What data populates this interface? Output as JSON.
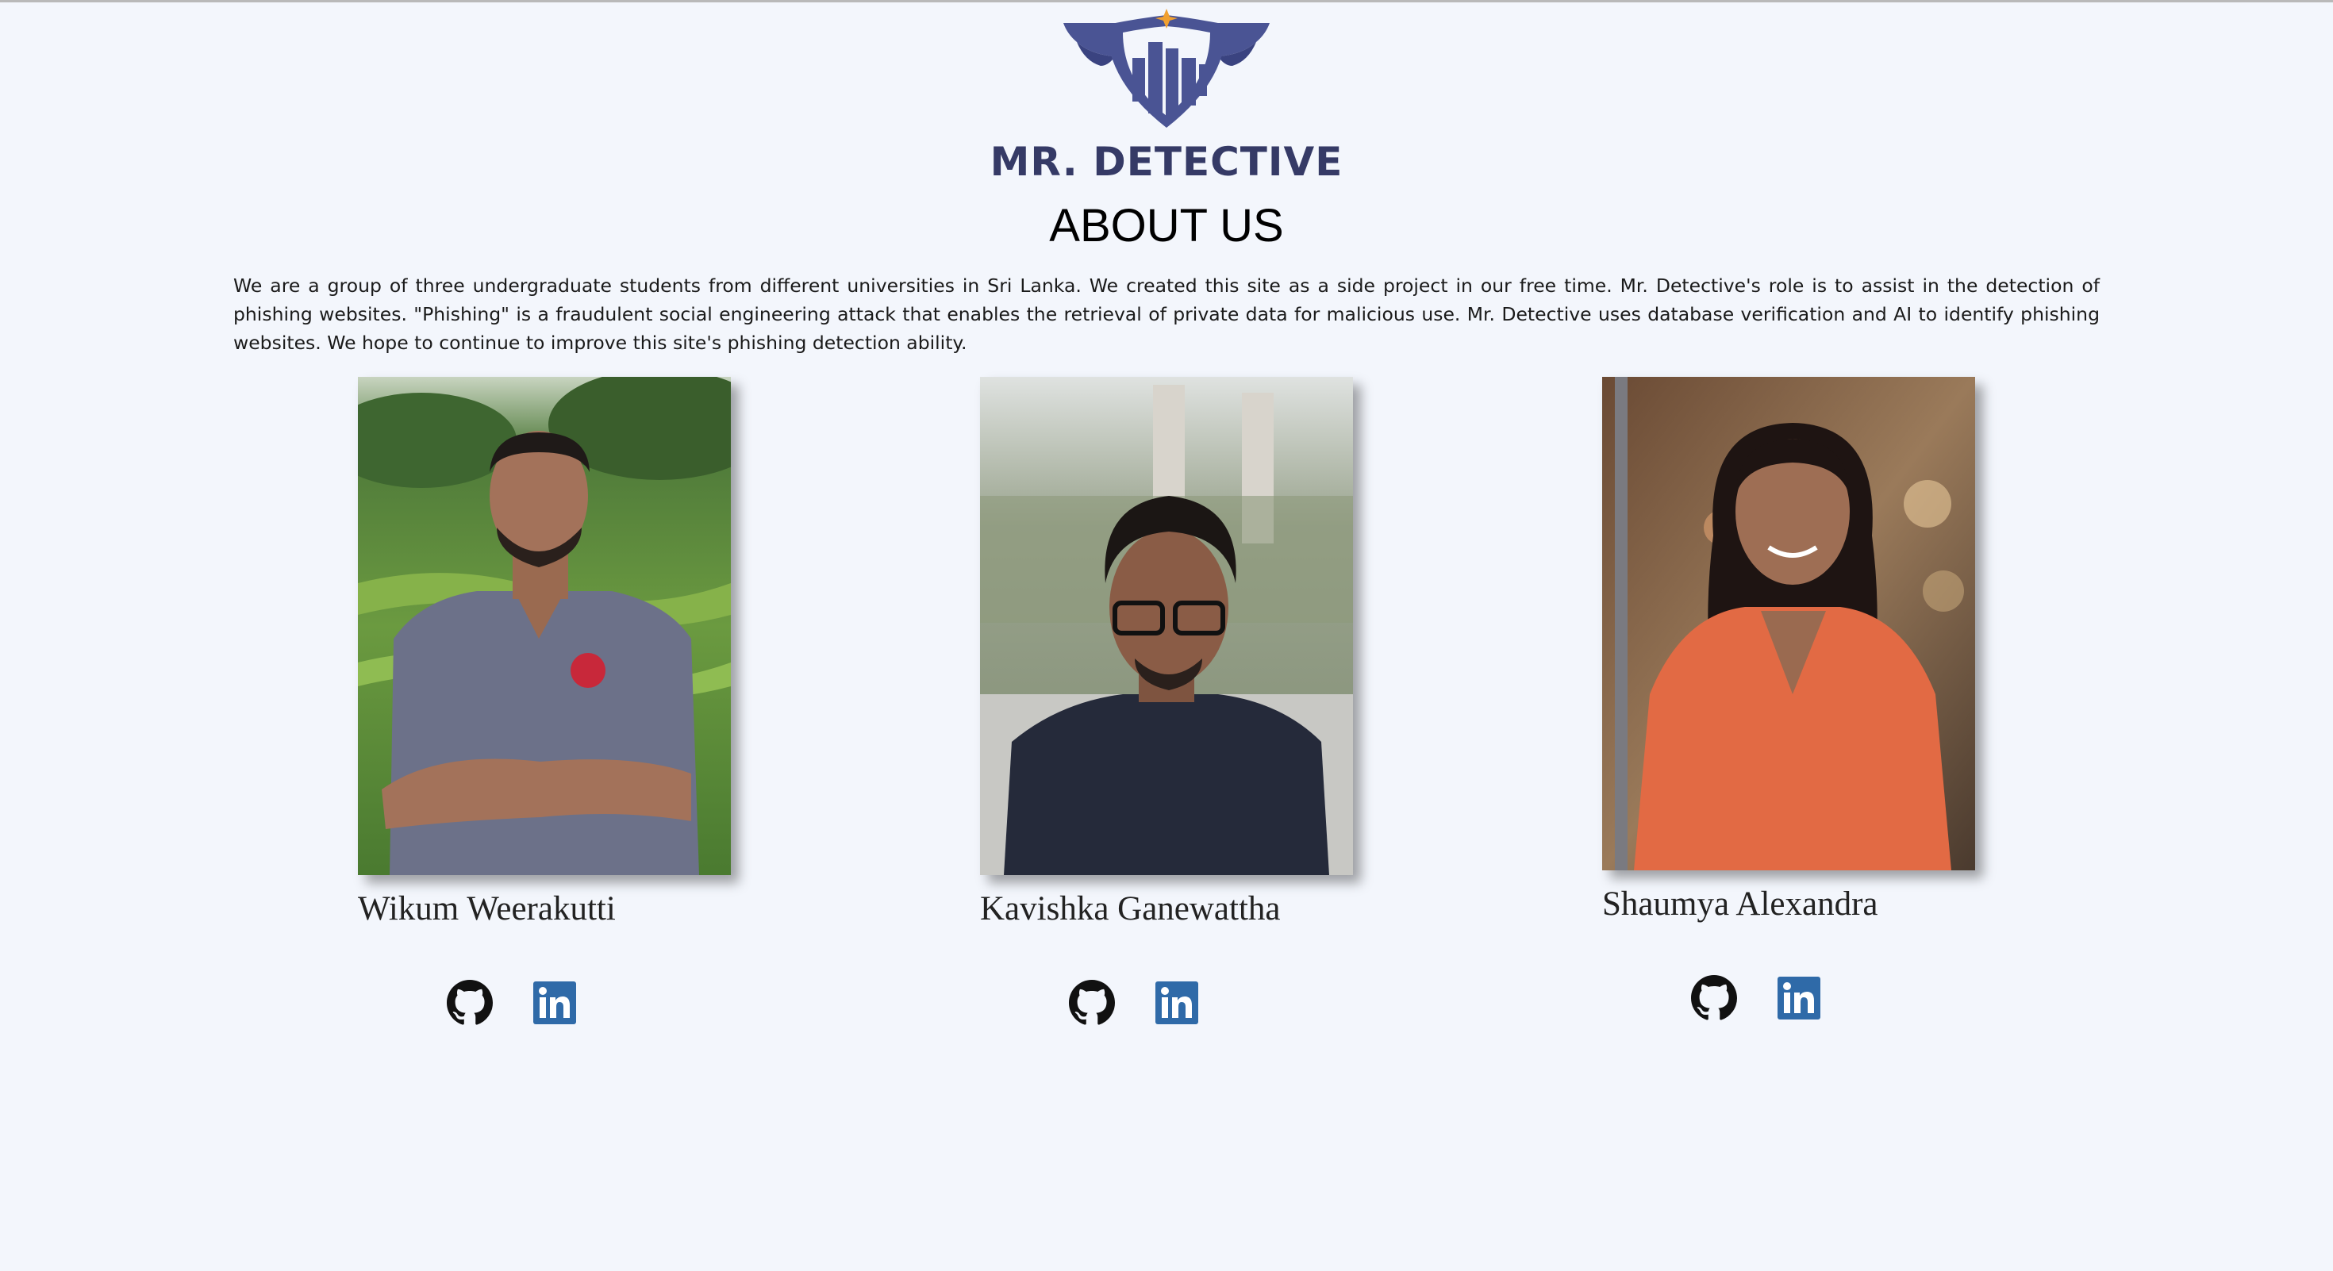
{
  "brand": {
    "name": "MR. DETECTIVE",
    "logo_icon": "shield-city-logo-icon",
    "colors": {
      "primary": "#353a66",
      "shield": "#4a5494",
      "star": "#f0a030"
    }
  },
  "page": {
    "title": "ABOUT US",
    "description": "We are a group of three undergraduate students from different universities in Sri Lanka. We created this site as a side project in our free time. Mr. Detective's role is to assist in the detection of phishing websites. \"Phishing\" is a fraudulent social engineering attack that enables the retrieval of private data for malicious use. Mr. Detective uses database verification and AI to identify phishing websites. We hope to continue to improve this site's phishing detection ability."
  },
  "team": [
    {
      "name": "Wikum Weerakutti",
      "social_icons": [
        "github-icon",
        "linkedin-icon"
      ]
    },
    {
      "name": "Kavishka Ganewattha",
      "social_icons": [
        "github-icon",
        "linkedin-icon"
      ]
    },
    {
      "name": "Shaumya Alexandra",
      "social_icons": [
        "github-icon",
        "linkedin-icon"
      ]
    }
  ],
  "colors": {
    "background": "#f3f6fc",
    "linkedin": "#2f6aa8",
    "github": "#111111"
  }
}
